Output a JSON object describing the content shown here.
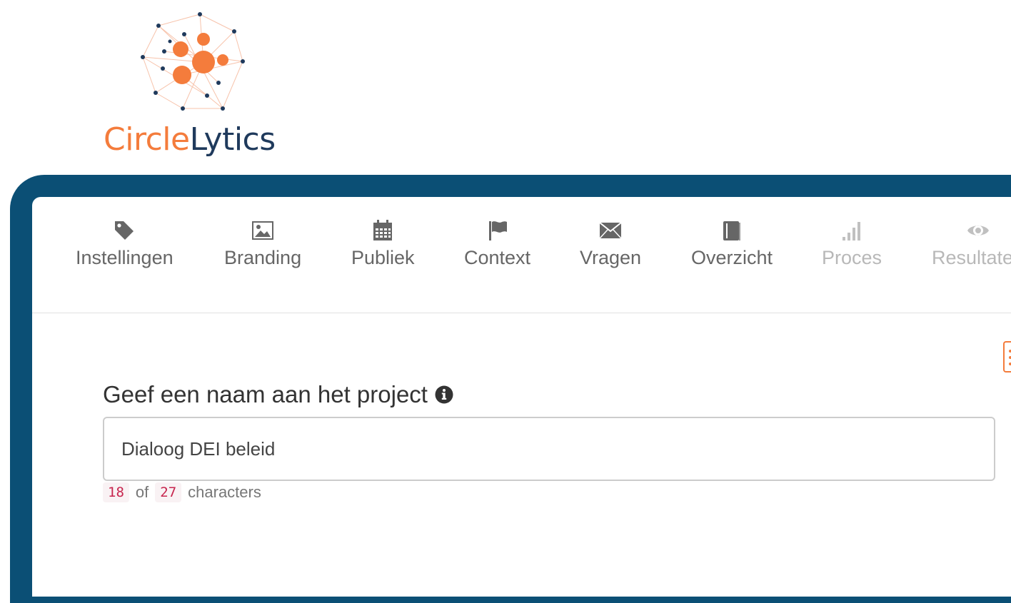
{
  "brand": {
    "name_part1": "Circle",
    "name_part2": "Lytics",
    "accent_color": "#f47c3c",
    "dark_color": "#1f3a5c",
    "frame_color": "#0b4f75"
  },
  "tabs": [
    {
      "label": "Instellingen",
      "icon": "tag-icon",
      "enabled": true
    },
    {
      "label": "Branding",
      "icon": "image-icon",
      "enabled": true
    },
    {
      "label": "Publiek",
      "icon": "calendar-icon",
      "enabled": true
    },
    {
      "label": "Context",
      "icon": "flag-icon",
      "enabled": true
    },
    {
      "label": "Vragen",
      "icon": "envelope-icon",
      "enabled": true
    },
    {
      "label": "Overzicht",
      "icon": "book-icon",
      "enabled": true
    },
    {
      "label": "Proces",
      "icon": "signal-icon",
      "enabled": false
    },
    {
      "label": "Resultaten",
      "icon": "eye-icon",
      "enabled": false
    }
  ],
  "project_name": {
    "label": "Geef een naam aan het project",
    "value": "Dialoog DEI beleid",
    "count_current": "18",
    "count_of": "of",
    "count_max": "27",
    "count_suffix": "characters"
  }
}
